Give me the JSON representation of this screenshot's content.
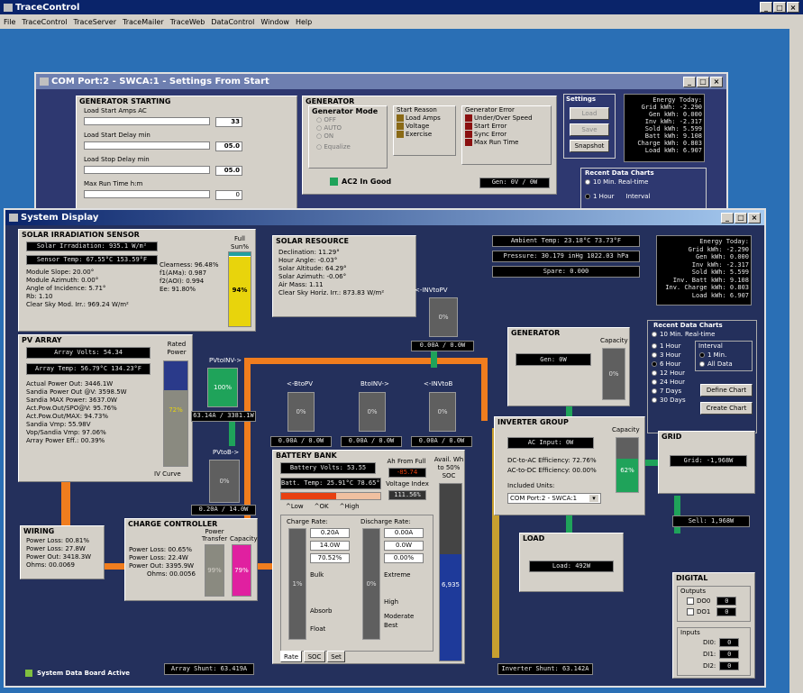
{
  "app": {
    "title": "TraceControl",
    "menu": [
      "File",
      "TraceControl",
      "TraceServer",
      "TraceMailer",
      "TraceWeb",
      "DataControl",
      "Window",
      "Help"
    ]
  },
  "settings_window": {
    "title": "COM Port:2 - SWCA:1 - Settings From Start",
    "gen_start": {
      "title": "GENERATOR STARTING",
      "rows": [
        {
          "label": "Load Start Amps AC",
          "value": "33"
        },
        {
          "label": "Load Start Delay min",
          "value": "05.0"
        },
        {
          "label": "Load Stop Delay min",
          "value": "05.0"
        },
        {
          "label": "Max Run Time h:m",
          "value": "0"
        }
      ]
    },
    "generator": {
      "title": "GENERATOR",
      "mode_title": "Generator Mode",
      "modes": [
        "OFF",
        "AUTO",
        "ON",
        "Equalize"
      ],
      "reason_title": "Start Reason",
      "reasons": [
        "Load Amps",
        "Voltage",
        "Exercise"
      ],
      "error_title": "Generator Error",
      "errors": [
        "Under/Over Speed",
        "Start Error",
        "Sync Error",
        "Max Run Time"
      ],
      "ac2": "AC2 In Good",
      "gen_readout": "Gen: 0V / 0W"
    },
    "settings": {
      "title": "Settings",
      "buttons": [
        "Load",
        "Save",
        "Snapshot"
      ]
    },
    "energy": [
      "Energy Today:",
      "Grid kWh: -2.290",
      "Gen kWh: 0.000",
      "Inv kWh: -2.317",
      "Sold kWh: 5.599",
      "Batt kWh: 9.108",
      "Charge kWh: 0.803",
      "Load kWh: 6.907"
    ],
    "recent": {
      "title": "Recent Data Charts",
      "items": [
        "10 Min. Real-time",
        "1 Hour",
        "Interval"
      ]
    }
  },
  "system": {
    "title": "System Display",
    "solar_irr": {
      "title": "SOLAR IRRADIATION SENSOR",
      "irradiation": "Solar Irradiation: 935.1 W/m²",
      "sensor_temp": "Sensor Temp: 67.55°C 153.59°F",
      "lines": [
        "Module Slope: 20.00°",
        "Module Azimuth: 0.00°",
        "Angle of Incidence: 5.71°",
        "Rb: 1.10",
        "Clear Sky Mod. Irr.: 969.24 W/m²"
      ],
      "clear": [
        "Clearness: 96.48%",
        "f1(AMa): 0.987",
        "f2(AOI): 0.994",
        "Ee: 91.80%"
      ],
      "full_sun_label": "Full Sun%",
      "full_sun": "94%",
      "full_sun_pct": 94
    },
    "solar_res": {
      "title": "SOLAR RESOURCE",
      "lines": [
        "Declination: 11.29°",
        "Hour Angle: -0.03°",
        "Solar Altitude: 64.29°",
        "Solar Azimuth: -0.06°",
        "Air Mass: 1.11",
        "Clear Sky Horiz. Irr.: 873.83 W/m²"
      ]
    },
    "env": {
      "ambient": "Ambient Temp: 23.18°C 73.73°F",
      "pressure": "Pressure: 30.179 inHg 1022.03 hPa",
      "spare": "Spare: 0.000"
    },
    "energy": [
      "Energy Today:",
      "Grid kWh: -2.290",
      "Gen kWh: 0.000",
      "Inv kWh: -2.317",
      "Sold kWh: 5.599",
      "Inv. Batt kWh: 9.108",
      "Inv. Charge kWh: 0.803",
      "Load kWh: 6.907"
    ],
    "pv": {
      "title": "PV ARRAY",
      "volts": "Array Volts: 54.34",
      "temp": "Array Temp: 56.79°C 134.23°F",
      "rated_label": "Rated Power",
      "rated": "72%",
      "rated_pct": 72,
      "lines": [
        "Actual Power Out: 3446.1W",
        "Sandia Power Out @V: 3598.5W",
        "Sandia MAX Power: 3637.0W",
        "Act.Pow.Out/SPO@V: 95.76%",
        "Act.Pow.Out/MAX: 94.73%",
        "Sandia Vmp: 55.98V",
        "Vop/Sandia Vmp: 97.06%",
        "Array Power Eff.: 00.39%"
      ],
      "iv": "IV Curve"
    },
    "flows": {
      "pvtoinv_label": "PVtoINV->",
      "pvtoinv_pct": "100%",
      "pvtoinv_val": "63.14A / 3381.1W",
      "invtopv_label": "<-INVtoPV",
      "invtopv_pct": "0%",
      "invtopv_val": "0.00A / 0.0W",
      "btopv_label": "<-BtoPV",
      "btopv_pct": "0%",
      "btopv_val": "0.00A / 0.0W",
      "btoinv_label": "BtoINV->",
      "btoinv_pct": "0%",
      "btoinv_val": "0.00A / 0.0W",
      "invtob_label": "<-INVtoB",
      "invtob_pct": "0%",
      "invtob_val": "0.00A / 0.0W",
      "pvtob_label": "PVtoB->",
      "pvtob_pct": "0%",
      "pvtob_val": "0.20A / 14.0W"
    },
    "generator": {
      "title": "GENERATOR",
      "capacity_label": "Capacity",
      "readout": "Gen: 0W",
      "pct": "0%"
    },
    "recent": {
      "title": "Recent Data Charts",
      "realtime": "10 Min. Real-time",
      "options": [
        "1 Hour",
        "3 Hour",
        "6 Hour",
        "12 Hour",
        "24 Hour",
        "7 Days",
        "30 Days"
      ],
      "interval_title": "Interval",
      "interval": [
        "1 Min.",
        "All Data"
      ],
      "define": "Define Chart",
      "create": "Create Chart"
    },
    "battery": {
      "title": "BATTERY BANK",
      "volts": "Battery Volts: 53.55",
      "temp": "Batt. Temp: 25.91°C 78.65°F",
      "ah_label": "Ah From Full",
      "ah": "-85.74",
      "vindex_label": "Voltage Index",
      "vindex": "111.56%",
      "scale": [
        "^Low",
        "^OK",
        "^High"
      ],
      "avail_label": "Avail. Wh to 50% SOC",
      "avail": "6,935",
      "avail_pct": 60,
      "charge_title": "Charge Rate:",
      "charge": [
        "0.20A",
        "14.0W",
        "70.52%"
      ],
      "charge_pct": "1%",
      "charge_states": [
        "Bulk",
        "Absorb",
        "Float"
      ],
      "discharge_title": "Discharge Rate:",
      "discharge": [
        "0.00A",
        "0.0W",
        "0.00%"
      ],
      "discharge_pct": "0%",
      "discharge_states": [
        "Extreme",
        "High",
        "Moderate",
        "Best"
      ],
      "tabs": [
        "Rate",
        "SOC",
        "Set"
      ]
    },
    "inverter": {
      "title": "INVERTER GROUP",
      "capacity_label": "Capacity",
      "ac_input": "AC Input: 0W",
      "dc_ac": "DC-to-AC Efficiency: 72.76%",
      "ac_dc": "AC-to-DC Efficiency: 00.00%",
      "units_label": "Included Units:",
      "units": "COM Port:2 - SWCA:1",
      "pct": "62%",
      "pct_val": 62
    },
    "grid": {
      "title": "GRID",
      "readout": "Grid: -1,968W",
      "sell": "Sell: 1,968W"
    },
    "load": {
      "title": "LOAD",
      "readout": "Load: 492W"
    },
    "wiring": {
      "title": "WIRING",
      "lines": [
        "Power Loss: 00.81%",
        "Power Loss: 27.8W",
        "Power Out: 3418.3W",
        "Ohms: 00.0069"
      ]
    },
    "charge_ctrl": {
      "title": "CHARGE CONTROLLER",
      "lines": [
        "Power Loss: 00.65%",
        "Power Loss: 22.4W",
        "Power Out: 3395.9W",
        "Ohms: 00.0056"
      ],
      "pt_label": "Power Transfer",
      "pt": "99%",
      "cap_label": "Capacity",
      "cap": "79%"
    },
    "digital": {
      "title": "DIGITAL",
      "outputs_title": "Outputs",
      "outputs": [
        {
          "label": "DO0",
          "value": "0"
        },
        {
          "label": "DO1",
          "value": "0"
        }
      ],
      "inputs_title": "Inputs",
      "inputs": [
        {
          "label": "DI0:",
          "value": "0"
        },
        {
          "label": "DI1:",
          "value": "0"
        },
        {
          "label": "DI2:",
          "value": "0"
        }
      ]
    },
    "array_shunt": "Array Shunt: 63.419A",
    "inverter_shunt": "Inverter Shunt: 63.142A",
    "status": "System Data Board Active"
  },
  "colors": {
    "accent": "#f07d1e",
    "green": "#1fa35a",
    "yellow": "#e8d40c",
    "panel_bg": "#24305c"
  }
}
